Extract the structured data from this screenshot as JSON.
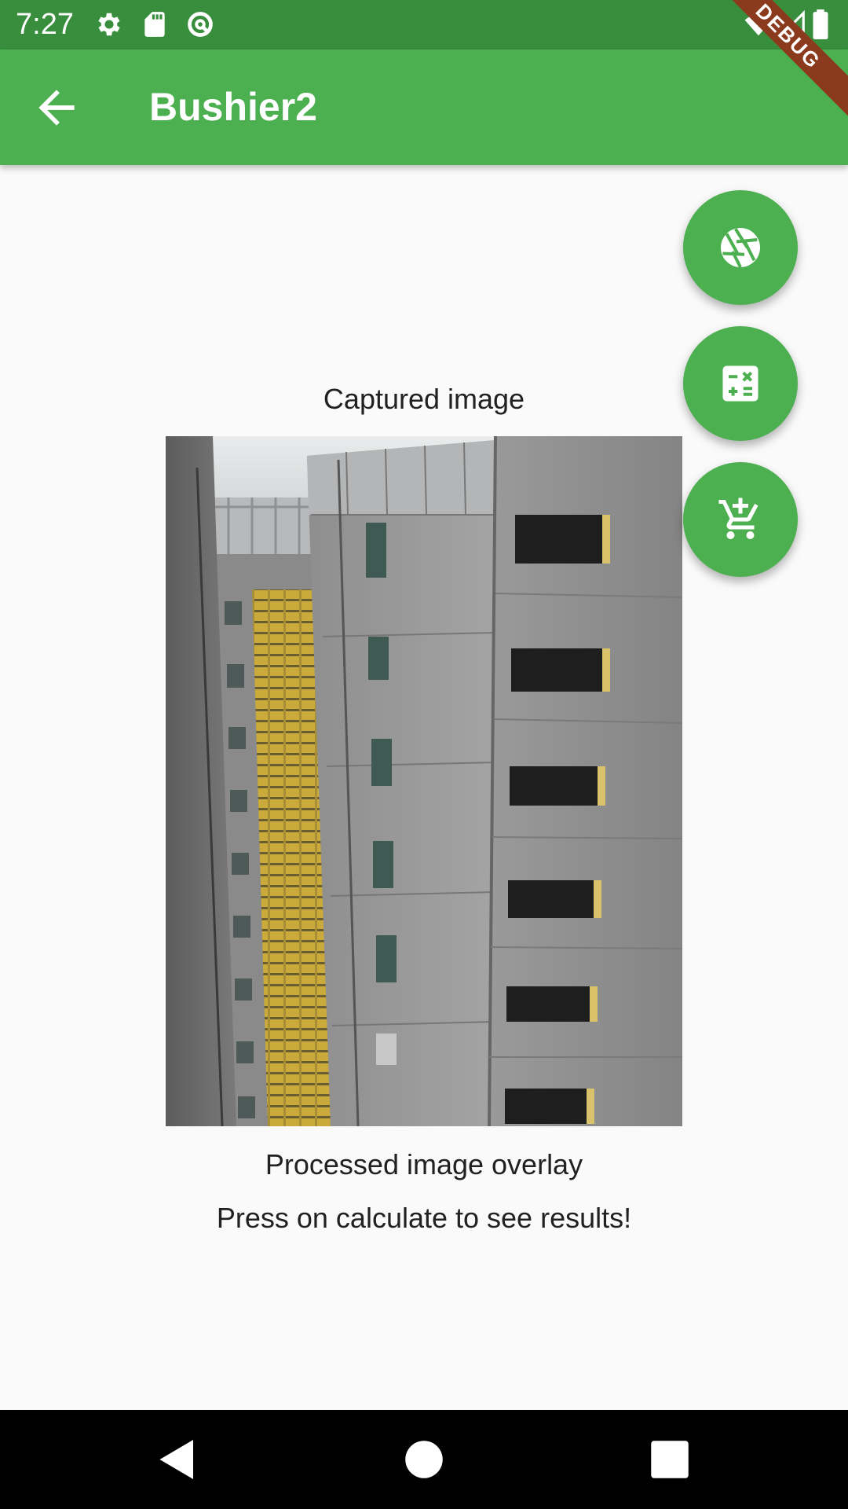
{
  "status_bar": {
    "time": "7:27",
    "icons": [
      "settings-icon",
      "sd-card-icon",
      "sync-icon",
      "wifi-icon",
      "signal-icon",
      "battery-icon"
    ],
    "background": "#388e3c"
  },
  "debug_banner": {
    "text": "DEBUG"
  },
  "app_bar": {
    "title": "Bushier2",
    "back_icon": "arrow-back-icon",
    "background": "#4caf50"
  },
  "content": {
    "captured_label": "Captured image",
    "processed_label": "Processed image overlay",
    "hint_text": "Press on calculate to see results!"
  },
  "fabs": [
    {
      "name": "camera-capture-button",
      "icon": "camera-shutter-icon"
    },
    {
      "name": "calculate-button",
      "icon": "calculator-icon"
    },
    {
      "name": "add-to-cart-button",
      "icon": "add-shopping-cart-icon"
    }
  ],
  "nav_bar": {
    "buttons": [
      "back-triangle-icon",
      "home-circle-icon",
      "recents-square-icon"
    ]
  },
  "colors": {
    "primary": "#4caf50",
    "primary_dark": "#388e3c",
    "background": "#fafafa",
    "text": "#212121"
  }
}
